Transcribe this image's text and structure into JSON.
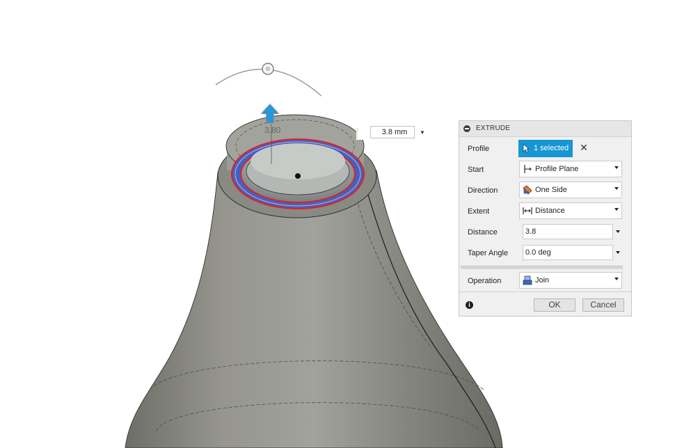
{
  "viewport": {
    "dimension_label": "3.80",
    "dimension_input": {
      "value": "3.8 mm"
    }
  },
  "extrude_panel": {
    "title": "EXTRUDE",
    "profile": {
      "label": "Profile",
      "selection": "1 selected"
    },
    "start": {
      "label": "Start",
      "value": "Profile Plane"
    },
    "direction": {
      "label": "Direction",
      "value": "One Side"
    },
    "extent": {
      "label": "Extent",
      "value": "Distance"
    },
    "distance": {
      "label": "Distance",
      "value": "3.8"
    },
    "taper_angle": {
      "label": "Taper Angle",
      "value": "0.0 deg"
    },
    "operation": {
      "label": "Operation",
      "value": "Join"
    },
    "ok_label": "OK",
    "cancel_label": "Cancel"
  },
  "colors": {
    "selection_blue": "#1696d2",
    "profile_ring": "#3e63c4",
    "body_gray": "#8a8a82"
  },
  "icons": [
    "minus-circle-icon",
    "cursor-icon",
    "close-icon",
    "start-plane-icon",
    "direction-icon",
    "distance-icon",
    "join-icon",
    "info-icon",
    "arrow-up-icon"
  ]
}
